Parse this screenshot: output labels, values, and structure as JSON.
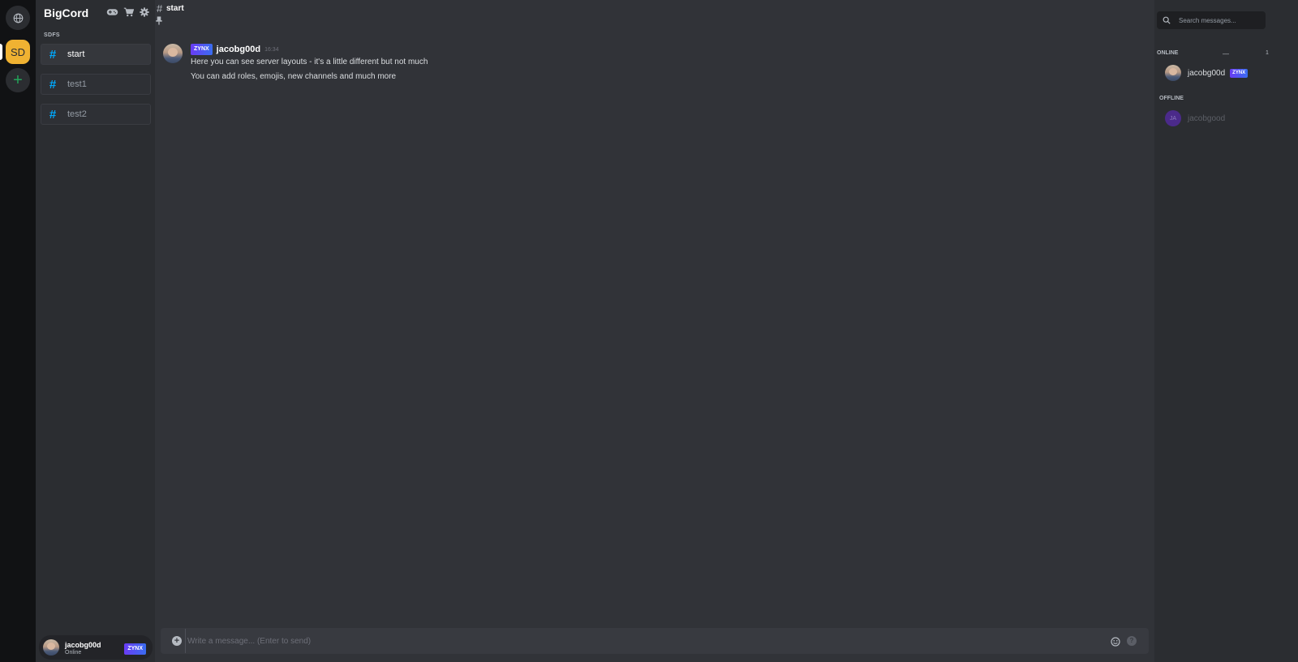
{
  "server_rail": {
    "active_server_initials": "SD",
    "add_server_glyph": "+"
  },
  "sidebar": {
    "server_name": "BigCord",
    "tool_icons": [
      "gamepad-icon",
      "cart-icon",
      "gear-icon"
    ],
    "category": "SDFS",
    "channels": [
      {
        "label": "start",
        "active": true
      },
      {
        "label": "test1",
        "active": false
      },
      {
        "label": "test2",
        "active": false
      }
    ],
    "user": {
      "name": "jacobg00d",
      "status": "Online",
      "badge": "ZYNX"
    }
  },
  "channel_header": {
    "hash": "#",
    "name": "start"
  },
  "messages": [
    {
      "badge": "ZYNX",
      "author": "jacobg00d",
      "time": "16:34",
      "lines": [
        "Here you can see server layouts - it's a little different but not much",
        "You can add roles, emojis, new channels and much more"
      ]
    }
  ],
  "composer": {
    "placeholder": "Write a message... (Enter to send)"
  },
  "member_list": {
    "search_placeholder": "Search messages...",
    "online": {
      "title": "ONLINE",
      "dash": "—",
      "count": "1",
      "members": [
        {
          "name": "jacobg00d",
          "badge": "ZYNX"
        }
      ]
    },
    "offline": {
      "title": "OFFLINE",
      "members": [
        {
          "name": "jacobgood",
          "initials": "JA"
        }
      ]
    }
  },
  "colors": {
    "accent_hash": "#00a8fc",
    "server_icon": "#f0b232",
    "add_server": "#23a55a"
  }
}
